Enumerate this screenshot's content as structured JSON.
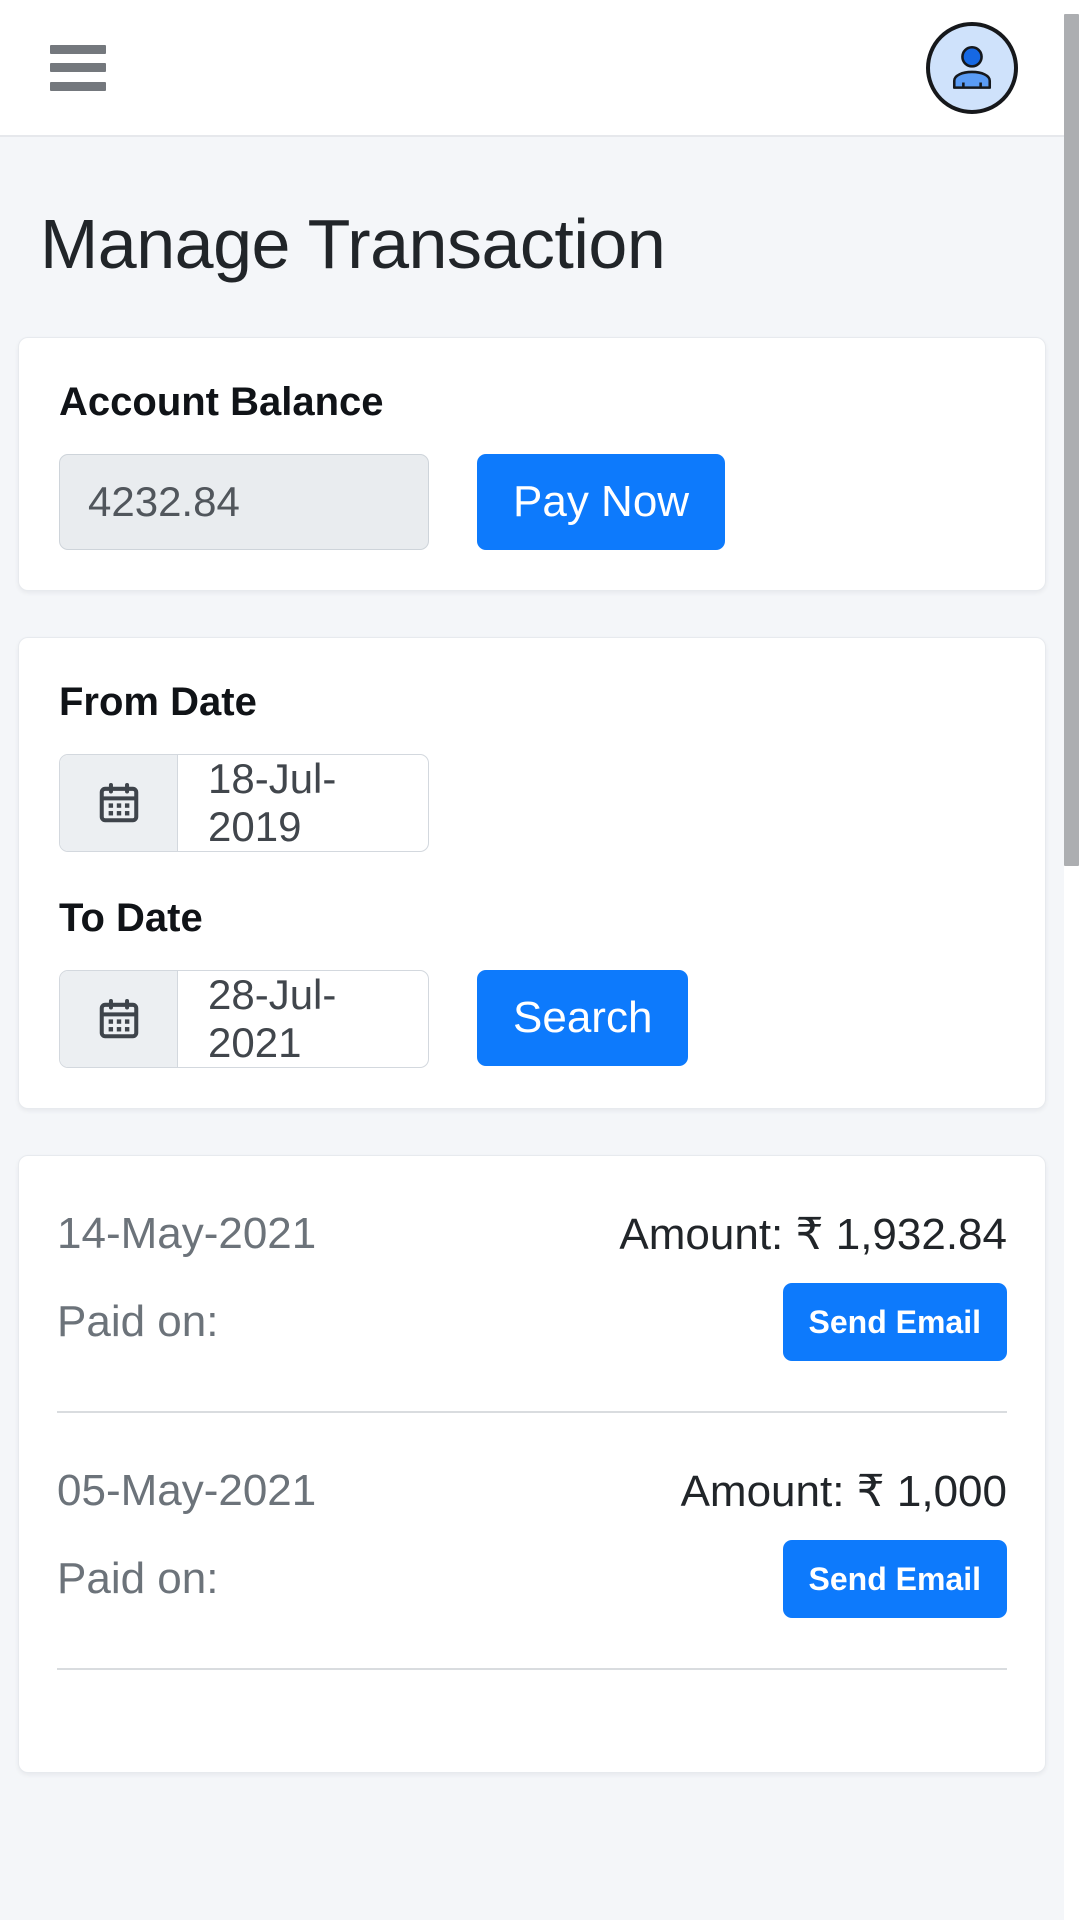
{
  "navbar": {
    "menu_icon": "hamburger-menu-icon",
    "avatar_icon": "user-avatar-icon"
  },
  "page": {
    "title": "Manage Transaction",
    "background_color": "#f4f6f9",
    "accent_color": "#0d7afc"
  },
  "balance_card": {
    "label": "Account Balance",
    "value": "4232.84",
    "pay_button": "Pay Now"
  },
  "date_card": {
    "from_label": "From Date",
    "from_value": "18-Jul-2019",
    "from_icon": "calendar-icon",
    "to_label": "To Date",
    "to_value": "28-Jul-2021",
    "to_icon": "calendar-icon",
    "search_button": "Search"
  },
  "transactions": {
    "paid_on_label": "Paid on:",
    "send_email_label": "Send Email",
    "rows": [
      {
        "date": "14-May-2021",
        "amount": "Amount: ₹ 1,932.84",
        "paid_on": "Paid on:",
        "send_email": "Send Email"
      },
      {
        "date": "05-May-2021",
        "amount": "Amount: ₹ 1,000",
        "paid_on": "Paid on:",
        "send_email": "Send Email"
      }
    ]
  },
  "scrollbar": {
    "name": "vertical-scrollbar"
  }
}
